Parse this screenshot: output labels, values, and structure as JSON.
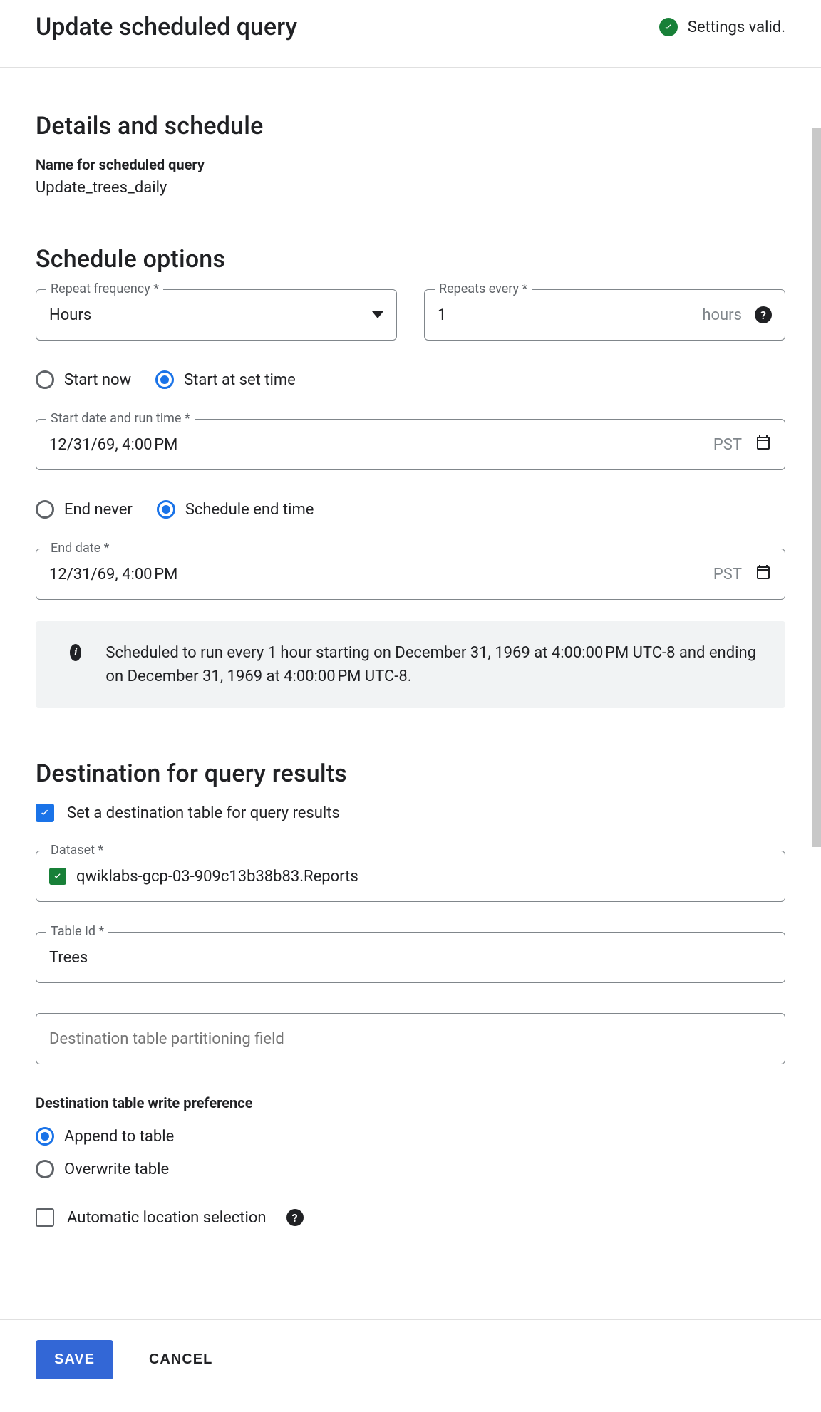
{
  "header": {
    "title": "Update scheduled query",
    "status_text": "Settings valid."
  },
  "details": {
    "section_title": "Details and schedule",
    "name_label": "Name for scheduled query",
    "name_value": "Update_trees_daily"
  },
  "schedule": {
    "section_title": "Schedule options",
    "repeat_freq_label": "Repeat frequency",
    "repeat_freq_value": "Hours",
    "repeats_every_label": "Repeats every",
    "repeats_every_value": "1",
    "repeats_every_suffix": "hours",
    "start_radio": {
      "now": "Start now",
      "set": "Start at set time",
      "selected": "set"
    },
    "start_date_label": "Start date and run time",
    "start_date_value": "12/31/69, 4:00 PM",
    "start_tz": "PST",
    "end_radio": {
      "never": "End never",
      "set": "Schedule end time",
      "selected": "set"
    },
    "end_date_label": "End date",
    "end_date_value": "12/31/69, 4:00 PM",
    "end_tz": "PST",
    "info_text": "Scheduled to run every 1 hour starting on December 31, 1969 at 4:00:00 PM UTC-8 and ending on December 31, 1969 at 4:00:00 PM UTC-8."
  },
  "destination": {
    "section_title": "Destination for query results",
    "set_dest_label": "Set a destination table for query results",
    "set_dest_checked": true,
    "dataset_label": "Dataset",
    "dataset_value": "qwiklabs-gcp-03-909c13b38b83.Reports",
    "tableid_label": "Table Id",
    "tableid_value": "Trees",
    "partition_placeholder": "Destination table partitioning field",
    "write_pref_label": "Destination table write preference",
    "write_pref": {
      "append": "Append to table",
      "overwrite": "Overwrite table",
      "selected": "append"
    },
    "auto_location_label": "Automatic location selection",
    "auto_location_checked": false
  },
  "footer": {
    "save": "SAVE",
    "cancel": "CANCEL"
  }
}
